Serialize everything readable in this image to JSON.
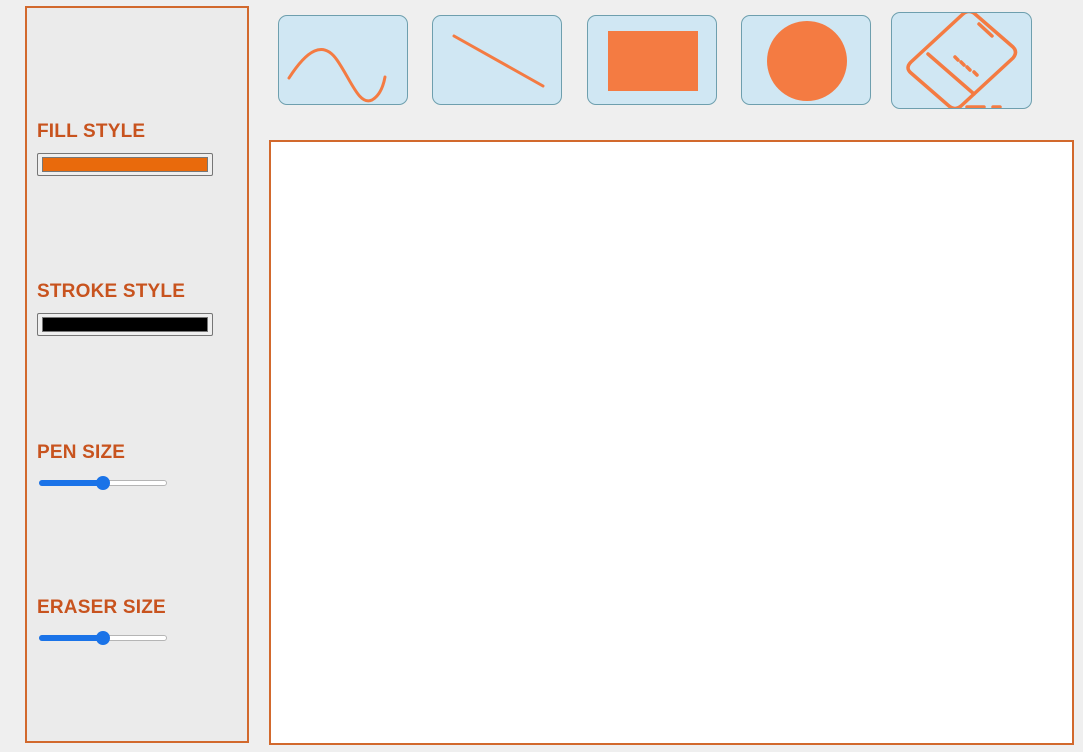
{
  "colors": {
    "accent": "#d2692d",
    "label": "#c8531e",
    "tool_bg": "#d0e7f3",
    "tool_border": "#6e9fae",
    "icon": "#f47b42",
    "slider": "#1a73e8",
    "canvas": "#ffffff"
  },
  "sidebar": {
    "fill_style": {
      "label": "FILL STYLE",
      "value": "#e96a0c"
    },
    "stroke_style": {
      "label": "STROKE STYLE",
      "value": "#000000"
    },
    "pen_size": {
      "label": "PEN SIZE",
      "level": 0.5
    },
    "eraser_size": {
      "label": "ERASER SIZE",
      "level": 0.5
    }
  },
  "toolbar": {
    "tools": [
      {
        "name": "freehand",
        "icon": "wave-curve-icon"
      },
      {
        "name": "line",
        "icon": "diagonal-line-icon"
      },
      {
        "name": "rectangle",
        "icon": "filled-rectangle-icon"
      },
      {
        "name": "circle",
        "icon": "filled-circle-icon"
      },
      {
        "name": "eraser",
        "icon": "eraser-icon"
      }
    ]
  }
}
